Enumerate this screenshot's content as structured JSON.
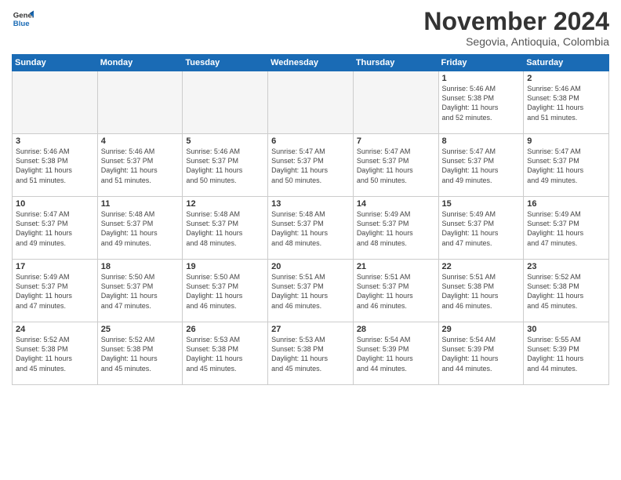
{
  "logo": {
    "general": "General",
    "blue": "Blue"
  },
  "header": {
    "month": "November 2024",
    "location": "Segovia, Antioquia, Colombia"
  },
  "weekdays": [
    "Sunday",
    "Monday",
    "Tuesday",
    "Wednesday",
    "Thursday",
    "Friday",
    "Saturday"
  ],
  "weeks": [
    [
      {
        "day": "",
        "info": ""
      },
      {
        "day": "",
        "info": ""
      },
      {
        "day": "",
        "info": ""
      },
      {
        "day": "",
        "info": ""
      },
      {
        "day": "",
        "info": ""
      },
      {
        "day": "1",
        "info": "Sunrise: 5:46 AM\nSunset: 5:38 PM\nDaylight: 11 hours\nand 52 minutes."
      },
      {
        "day": "2",
        "info": "Sunrise: 5:46 AM\nSunset: 5:38 PM\nDaylight: 11 hours\nand 51 minutes."
      }
    ],
    [
      {
        "day": "3",
        "info": "Sunrise: 5:46 AM\nSunset: 5:38 PM\nDaylight: 11 hours\nand 51 minutes."
      },
      {
        "day": "4",
        "info": "Sunrise: 5:46 AM\nSunset: 5:37 PM\nDaylight: 11 hours\nand 51 minutes."
      },
      {
        "day": "5",
        "info": "Sunrise: 5:46 AM\nSunset: 5:37 PM\nDaylight: 11 hours\nand 50 minutes."
      },
      {
        "day": "6",
        "info": "Sunrise: 5:47 AM\nSunset: 5:37 PM\nDaylight: 11 hours\nand 50 minutes."
      },
      {
        "day": "7",
        "info": "Sunrise: 5:47 AM\nSunset: 5:37 PM\nDaylight: 11 hours\nand 50 minutes."
      },
      {
        "day": "8",
        "info": "Sunrise: 5:47 AM\nSunset: 5:37 PM\nDaylight: 11 hours\nand 49 minutes."
      },
      {
        "day": "9",
        "info": "Sunrise: 5:47 AM\nSunset: 5:37 PM\nDaylight: 11 hours\nand 49 minutes."
      }
    ],
    [
      {
        "day": "10",
        "info": "Sunrise: 5:47 AM\nSunset: 5:37 PM\nDaylight: 11 hours\nand 49 minutes."
      },
      {
        "day": "11",
        "info": "Sunrise: 5:48 AM\nSunset: 5:37 PM\nDaylight: 11 hours\nand 49 minutes."
      },
      {
        "day": "12",
        "info": "Sunrise: 5:48 AM\nSunset: 5:37 PM\nDaylight: 11 hours\nand 48 minutes."
      },
      {
        "day": "13",
        "info": "Sunrise: 5:48 AM\nSunset: 5:37 PM\nDaylight: 11 hours\nand 48 minutes."
      },
      {
        "day": "14",
        "info": "Sunrise: 5:49 AM\nSunset: 5:37 PM\nDaylight: 11 hours\nand 48 minutes."
      },
      {
        "day": "15",
        "info": "Sunrise: 5:49 AM\nSunset: 5:37 PM\nDaylight: 11 hours\nand 47 minutes."
      },
      {
        "day": "16",
        "info": "Sunrise: 5:49 AM\nSunset: 5:37 PM\nDaylight: 11 hours\nand 47 minutes."
      }
    ],
    [
      {
        "day": "17",
        "info": "Sunrise: 5:49 AM\nSunset: 5:37 PM\nDaylight: 11 hours\nand 47 minutes."
      },
      {
        "day": "18",
        "info": "Sunrise: 5:50 AM\nSunset: 5:37 PM\nDaylight: 11 hours\nand 47 minutes."
      },
      {
        "day": "19",
        "info": "Sunrise: 5:50 AM\nSunset: 5:37 PM\nDaylight: 11 hours\nand 46 minutes."
      },
      {
        "day": "20",
        "info": "Sunrise: 5:51 AM\nSunset: 5:37 PM\nDaylight: 11 hours\nand 46 minutes."
      },
      {
        "day": "21",
        "info": "Sunrise: 5:51 AM\nSunset: 5:37 PM\nDaylight: 11 hours\nand 46 minutes."
      },
      {
        "day": "22",
        "info": "Sunrise: 5:51 AM\nSunset: 5:38 PM\nDaylight: 11 hours\nand 46 minutes."
      },
      {
        "day": "23",
        "info": "Sunrise: 5:52 AM\nSunset: 5:38 PM\nDaylight: 11 hours\nand 45 minutes."
      }
    ],
    [
      {
        "day": "24",
        "info": "Sunrise: 5:52 AM\nSunset: 5:38 PM\nDaylight: 11 hours\nand 45 minutes."
      },
      {
        "day": "25",
        "info": "Sunrise: 5:52 AM\nSunset: 5:38 PM\nDaylight: 11 hours\nand 45 minutes."
      },
      {
        "day": "26",
        "info": "Sunrise: 5:53 AM\nSunset: 5:38 PM\nDaylight: 11 hours\nand 45 minutes."
      },
      {
        "day": "27",
        "info": "Sunrise: 5:53 AM\nSunset: 5:38 PM\nDaylight: 11 hours\nand 45 minutes."
      },
      {
        "day": "28",
        "info": "Sunrise: 5:54 AM\nSunset: 5:39 PM\nDaylight: 11 hours\nand 44 minutes."
      },
      {
        "day": "29",
        "info": "Sunrise: 5:54 AM\nSunset: 5:39 PM\nDaylight: 11 hours\nand 44 minutes."
      },
      {
        "day": "30",
        "info": "Sunrise: 5:55 AM\nSunset: 5:39 PM\nDaylight: 11 hours\nand 44 minutes."
      }
    ]
  ]
}
